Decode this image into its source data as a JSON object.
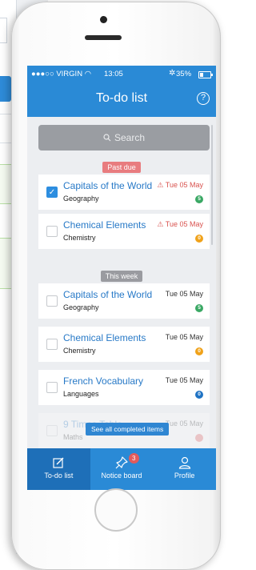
{
  "status_bar": {
    "carrier": "●●●○○ VIRGIN ◠",
    "time": "13:05",
    "battery": "35%"
  },
  "nav": {
    "title": "To-do list",
    "help_icon": "question-circle-icon"
  },
  "search": {
    "placeholder": "Search",
    "icon": "search-icon"
  },
  "sections": {
    "past_due": "Past due",
    "this_week": "This week"
  },
  "tasks_past_due": [
    {
      "title": "Capitals of the World",
      "subject": "Geography",
      "date": "Tue 05 May",
      "overdue": true,
      "checked": true,
      "badge": "5",
      "badge_color": "#3aa864"
    },
    {
      "title": "Chemical Elements",
      "subject": "Chemistry",
      "date": "Tue 05 May",
      "overdue": true,
      "checked": false,
      "badge": "0",
      "badge_color": "#f0a21a"
    }
  ],
  "tasks_this_week": [
    {
      "title": "Capitals of the World",
      "subject": "Geography",
      "date": "Tue 05 May",
      "badge": "5",
      "badge_color": "#3aa864"
    },
    {
      "title": "Chemical Elements",
      "subject": "Chemistry",
      "date": "Tue 05 May",
      "badge": "0",
      "badge_color": "#f0a21a"
    },
    {
      "title": "French Vocabulary",
      "subject": "Languages",
      "date": "Tue 05 May",
      "badge": "0",
      "badge_color": "#1f73c4"
    },
    {
      "title": "9 Times Table",
      "subject": "Maths",
      "date": "Tue 05 May",
      "badge": "",
      "badge_color": "#e25b5b"
    }
  ],
  "completed_link": "See all completed items",
  "tabs": [
    {
      "label": "To-do list",
      "icon": "edit-icon",
      "active": true
    },
    {
      "label": "Notice board",
      "icon": "pin-icon",
      "active": false,
      "badge": "3"
    },
    {
      "label": "Profile",
      "icon": "user-icon",
      "active": false
    }
  ],
  "colors": {
    "primary": "#2a8ad6",
    "overdue": "#d9534f"
  }
}
